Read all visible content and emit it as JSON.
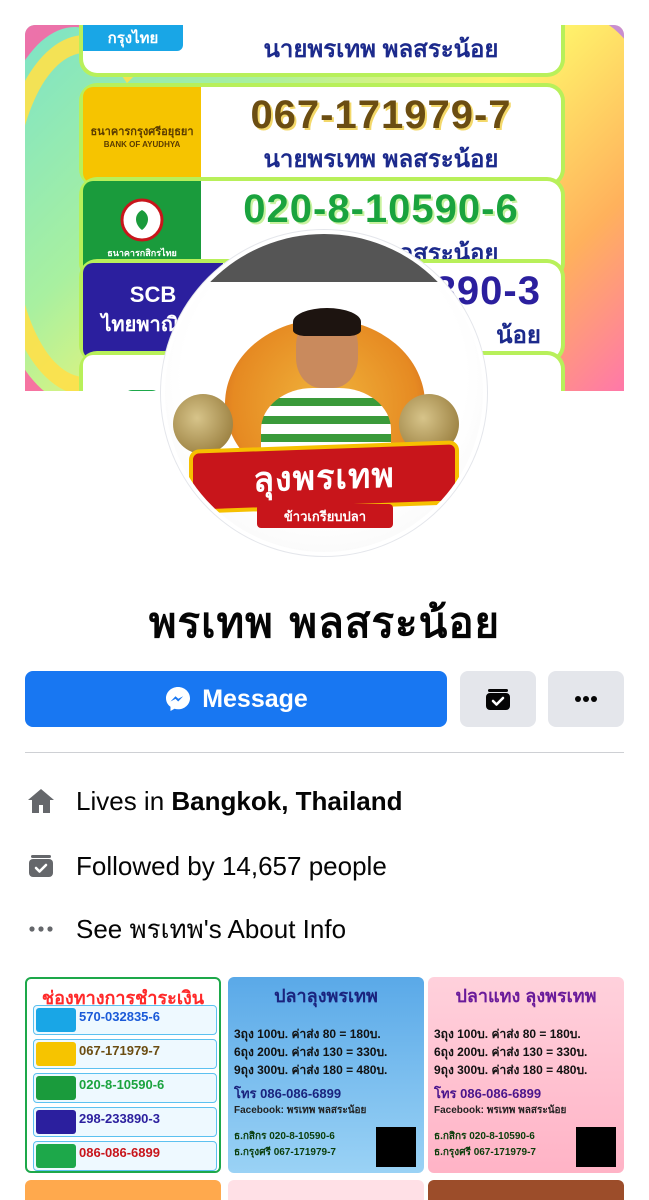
{
  "cover": {
    "bank_rows": [
      {
        "bank": "กรุงไทย",
        "number": "",
        "name": "นายพรเทพ  พลสระน้อย"
      },
      {
        "bank": "ธนาคารกรุงศรีอยุธยา",
        "bank_en": "BANK OF AYUDHYA",
        "number": "067-171979-7",
        "name": "นายพรเทพ  พลสระน้อย"
      },
      {
        "bank": "ธนาคารกสิกรไทย",
        "number": "020-8-10590-6",
        "name": "นายพรเทพ  พลสระน้อย"
      },
      {
        "bank": "SCB",
        "bank_th": "ไทยพาณิชย์",
        "number": "890-3",
        "name": "น้อย"
      }
    ]
  },
  "avatar": {
    "banner_text": "ลุงพรเทพ",
    "sub_text": "ข้าวเกรียบปลา"
  },
  "profile": {
    "name": "พรเทพ พลสระน้อย"
  },
  "actions": {
    "message_label": "Message"
  },
  "info": {
    "lives_prefix": "Lives in ",
    "lives_city": "Bangkok, Thailand",
    "followed": "Followed by 14,657 people",
    "about": "See พรเทพ's About Info"
  },
  "photos": [
    {
      "title": "ช่องทางการชำระเงิน",
      "rows": [
        {
          "number": "570-032835-6",
          "logo_color": "#19a6e6"
        },
        {
          "number": "067-171979-7",
          "logo_color": "#f6c400"
        },
        {
          "number": "020-8-10590-6",
          "logo_color": "#1a9b3c"
        },
        {
          "number": "298-233890-3",
          "logo_color": "#2b1f9e"
        },
        {
          "number": "086-086-6899",
          "logo_color": "#1da84a"
        }
      ]
    },
    {
      "title": "ปลาลุงพรเทพ",
      "lines": [
        "3ถุง 100บ. ค่าส่ง 80 = 180บ.",
        "6ถุง 200บ. ค่าส่ง 130 = 330บ.",
        "9ถุง 300บ. ค่าส่ง 180 = 480บ.",
        "โทร 086-086-6899",
        "Facebook: พรเทพ พลสระน้อย",
        "ธ.กสิกร 020-8-10590-6",
        "ธ.กรุงศรี 067-171979-7"
      ]
    },
    {
      "title": "ปลาแทง ลุงพรเทพ",
      "lines": [
        "3ถุง 100บ. ค่าส่ง 80 = 180บ.",
        "6ถุง 200บ. ค่าส่ง 130 = 330บ.",
        "9ถุง 300บ. ค่าส่ง 180 = 480บ.",
        "โทร 086-086-6899",
        "Facebook: พรเทพ พลสระน้อย",
        "ธ.กสิกร 020-8-10590-6",
        "ธ.กรุงศรี 067-171979-7"
      ]
    }
  ],
  "colors": {
    "accent": "#1877f2",
    "button_gray": "#e4e6eb",
    "divider": "#ced0d4"
  }
}
